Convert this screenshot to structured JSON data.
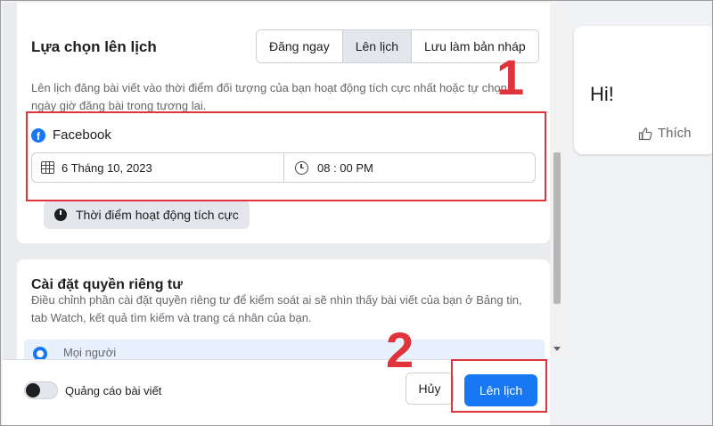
{
  "schedule": {
    "title": "Lựa chọn lên lịch",
    "tabs": [
      "Đăng ngay",
      "Lên lịch",
      "Lưu làm bản nháp"
    ],
    "description": "Lên lịch đăng bài viết vào thời điểm đối tượng của bạn hoạt động tích cực nhất hoặc tự chọn ngày giờ đăng bài trong tương lai.",
    "platform": "Facebook",
    "date": "6 Tháng 10, 2023",
    "time": "08 : 00 PM",
    "active_times_button": "Thời điểm hoạt động tích cực"
  },
  "privacy": {
    "title": "Cài đặt quyền riêng tư",
    "description": "Điều chỉnh phần cài đặt quyền riêng tư để kiểm soát ai sẽ nhìn thấy bài viết của bạn ở Bảng tin, tab Watch, kết quả tìm kiếm và trang cá nhân của bạn.",
    "option_label": "Mọi người"
  },
  "footer": {
    "boost_label": "Quảng cáo bài viết",
    "cancel_label": "Hủy",
    "schedule_label": "Lên lịch"
  },
  "preview": {
    "text": "Hi!",
    "like_label": "Thích"
  },
  "annotations": {
    "step1": "1",
    "step2": "2"
  },
  "colors": {
    "primary": "#1877f2",
    "highlight": "#e0333c"
  }
}
